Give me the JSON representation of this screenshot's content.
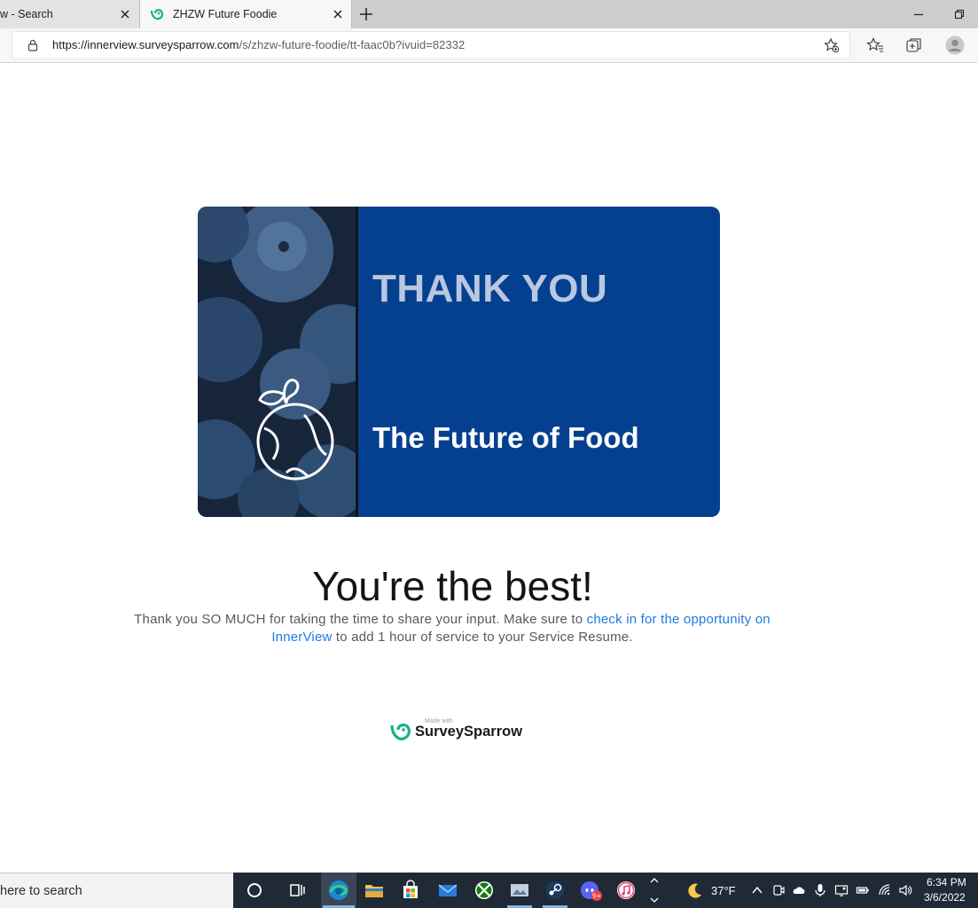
{
  "browser": {
    "tabs": [
      {
        "title": "w - Search"
      },
      {
        "title": "ZHZW Future Foodie"
      }
    ],
    "url_domain": "https://innerview.surveysparrow.com",
    "url_path": "/s/zhzw-future-foodie/tt-faac0b?ivuid=82332"
  },
  "banner": {
    "heading": "THANK YOU",
    "subheading": "The Future of Food"
  },
  "content": {
    "title": "You're the best!",
    "message_before": "Thank you SO MUCH for taking the time to share your input. Make sure to ",
    "message_link": "check in for the opportunity on InnerView",
    "message_after": " to add 1 hour of service to your Service Resume."
  },
  "footer": {
    "made_with": "Made with",
    "brand": "SurveySparrow"
  },
  "taskbar": {
    "search_text": "here to search",
    "weather_temp": "37°F",
    "time": "6:34 PM",
    "date": "3/6/2022",
    "discord_badge": "9+"
  },
  "colors": {
    "banner_blue": "#04408f",
    "link": "#1f7ae0",
    "brand_green": "#16b08a"
  }
}
